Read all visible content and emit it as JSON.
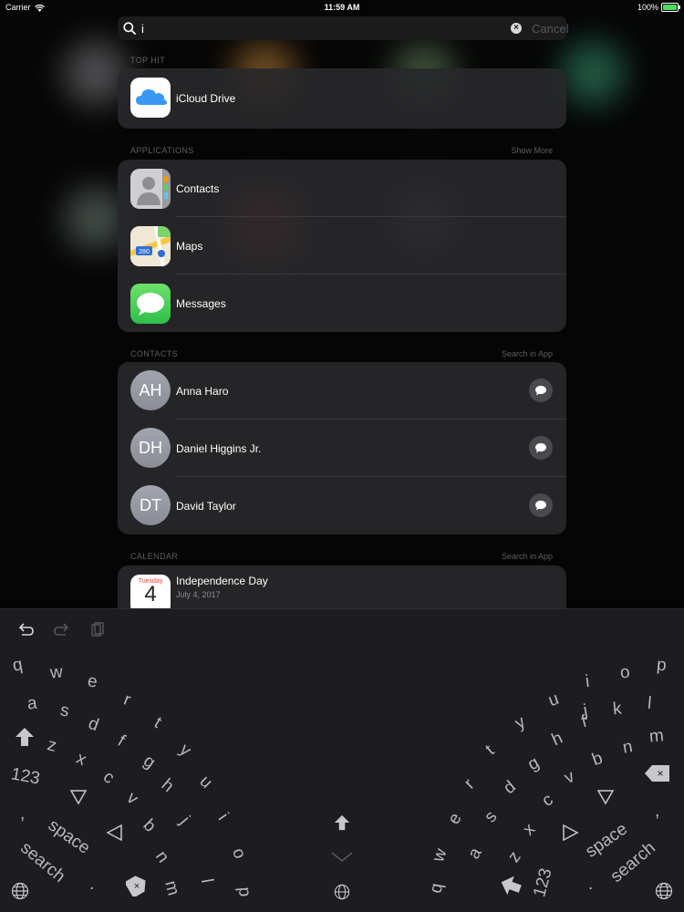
{
  "status": {
    "carrier": "Carrier",
    "time": "11:59 AM",
    "battery": "100%"
  },
  "search": {
    "query": "i",
    "cancel": "Cancel"
  },
  "sections": {
    "top_hit": "TOP HIT",
    "applications": "APPLICATIONS",
    "applications_action": "Show More",
    "contacts": "CONTACTS",
    "contacts_action": "Search in App",
    "calendar": "CALENDAR",
    "calendar_action": "Search in App"
  },
  "top_hit": {
    "label": "iCloud Drive"
  },
  "apps": [
    {
      "label": "Contacts",
      "icon": "contacts-app-icon"
    },
    {
      "label": "Maps",
      "icon": "maps-app-icon",
      "badge": "280"
    },
    {
      "label": "Messages",
      "icon": "messages-app-icon"
    }
  ],
  "contacts": [
    {
      "initials": "AH",
      "name": "Anna Haro"
    },
    {
      "initials": "DH",
      "name": "Daniel Higgins Jr."
    },
    {
      "initials": "DT",
      "name": "David Taylor"
    }
  ],
  "calendar": {
    "title": "Independence Day",
    "date": "July 4, 2017",
    "weekday": "Tuesday",
    "day": "4"
  },
  "keyboard": {
    "left": {
      "row1": [
        "q",
        "w",
        "e",
        "r",
        "t"
      ],
      "row2": [
        "a",
        "s",
        "d",
        "f",
        "g",
        "y"
      ],
      "row3": [
        "z",
        "x",
        "c",
        "v",
        "h",
        "u"
      ],
      "row4": [
        "b",
        "j",
        "i"
      ],
      "row5": [
        "n",
        "o"
      ],
      "row6": [
        "m",
        "l",
        "p"
      ],
      "num": "123",
      "comma": ",",
      "space": "space",
      "search": "search",
      "period": "."
    },
    "right": {
      "row1": [
        "i",
        "o",
        "p"
      ],
      "row2": [
        "u",
        "j",
        "k",
        "l"
      ],
      "row3": [
        "y",
        "h",
        "f",
        "b",
        "n",
        "m"
      ],
      "row4": [
        "t",
        "g",
        "v"
      ],
      "row5": [
        "r",
        "d",
        "c"
      ],
      "row6": [
        "e",
        "s",
        "x"
      ],
      "row7": [
        "w",
        "a",
        "z"
      ],
      "row8": [
        "q"
      ],
      "num": "123",
      "comma": ",",
      "space": "space",
      "search": "search",
      "period": "."
    }
  }
}
